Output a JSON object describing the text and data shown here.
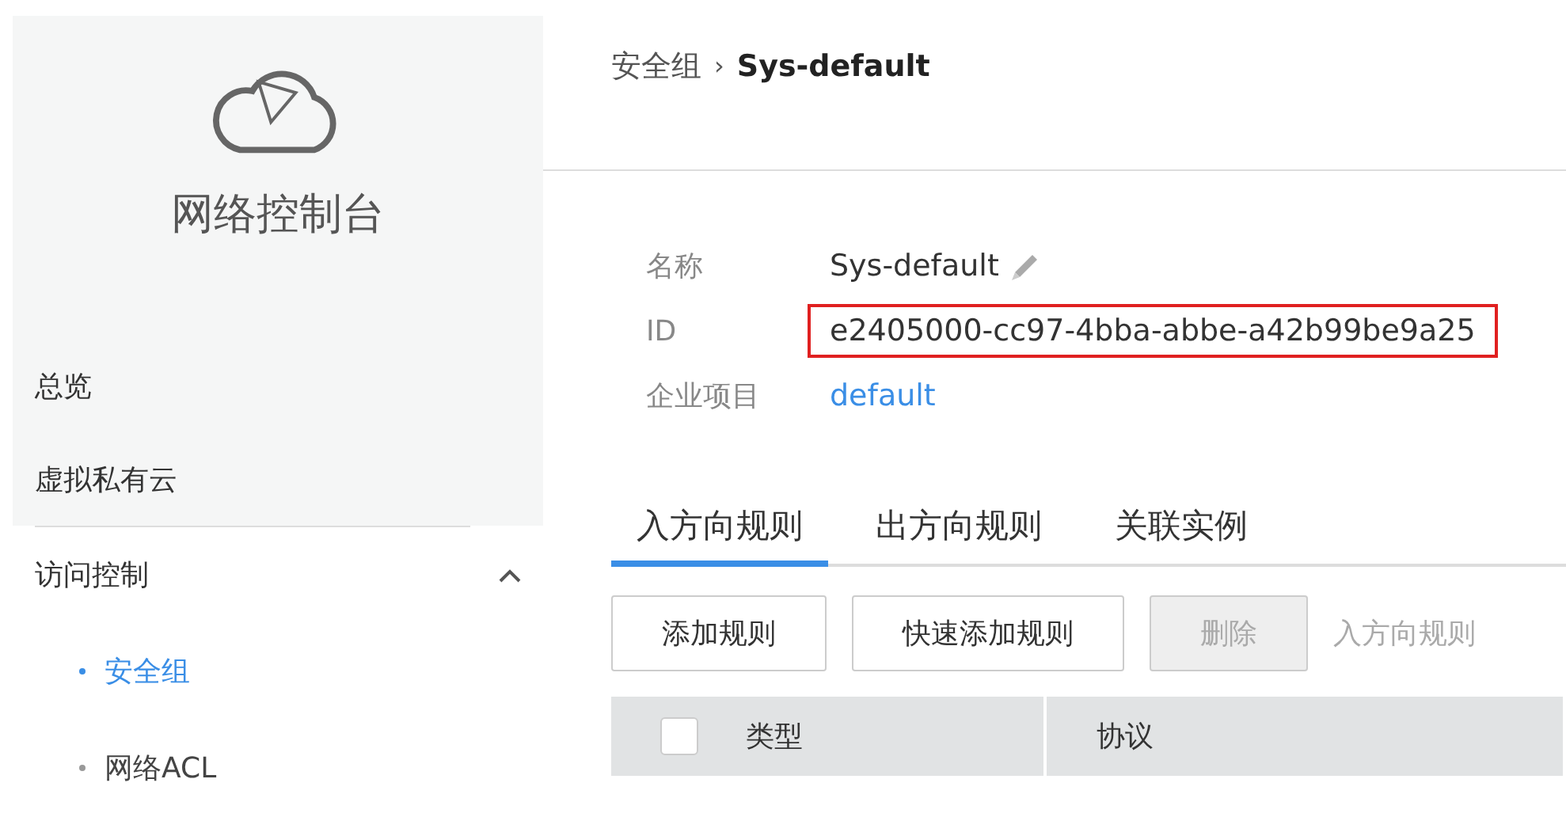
{
  "sidebar": {
    "title": "网络控制台",
    "items": [
      {
        "label": "总览",
        "selected": false
      },
      {
        "label": "虚拟私有云",
        "selected": false
      },
      {
        "label": "访问控制",
        "selected": false,
        "expanded": true,
        "children": [
          {
            "label": "安全组",
            "selected": true
          },
          {
            "label": "网络ACL",
            "selected": false
          }
        ]
      }
    ]
  },
  "breadcrumb": {
    "parent": "安全组",
    "separator": "›",
    "current": "Sys-default"
  },
  "details": [
    {
      "label": "名称",
      "value": "Sys-default",
      "kind": "editable"
    },
    {
      "label": "ID",
      "value": "e2405000-cc97-4bba-abbe-a42b99be9a25",
      "kind": "highlighted"
    },
    {
      "label": "企业项目",
      "value": "default",
      "kind": "link"
    }
  ],
  "tabs": [
    {
      "label": "入方向规则",
      "selected": true
    },
    {
      "label": "出方向规则",
      "selected": false
    },
    {
      "label": "关联实例",
      "selected": false
    }
  ],
  "buttons": [
    {
      "label": "添加规则",
      "disabled": false
    },
    {
      "label": "快速添加规则",
      "disabled": false
    },
    {
      "label": "删除",
      "disabled": true
    }
  ],
  "hint": "入方向规则",
  "table": {
    "select_all": {
      "checked": false
    },
    "columns": [
      "类型",
      "协议"
    ]
  }
}
